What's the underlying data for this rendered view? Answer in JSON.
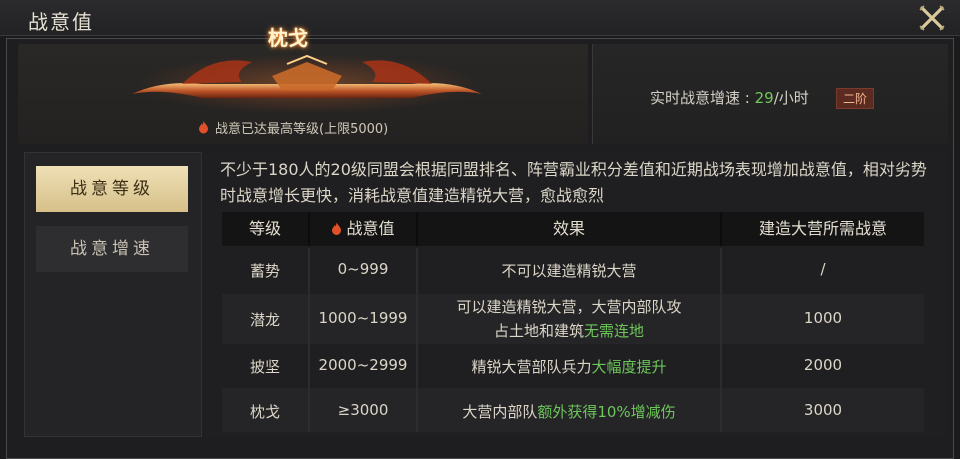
{
  "window": {
    "title": "战意值"
  },
  "hero": {
    "banner_name": "枕戈",
    "max_text": "战意已达最高等级(上限5000)"
  },
  "rate": {
    "prefix": "实时战意增速 : ",
    "value": "29",
    "unit": "/小时",
    "tier": "二阶"
  },
  "tabs": [
    {
      "label": "战意等级",
      "active": true
    },
    {
      "label": "战意增速",
      "active": false
    }
  ],
  "description": "不少于180人的20级同盟会根据同盟排名、阵营霸业积分差值和近期战场表现增加战意值，相对劣势时战意增长更快，消耗战意值建造精锐大营，愈战愈烈",
  "table": {
    "headers": [
      "等级",
      "战意值",
      "效果",
      "建造大营所需战意"
    ],
    "rows": [
      {
        "level": "蓄势",
        "value": "0~999",
        "effect": "不可以建造精锐大营",
        "effect_hl": "",
        "effect_line2": "",
        "effect_line2_hl": "",
        "cost": "/"
      },
      {
        "level": "潜龙",
        "value": "1000~1999",
        "effect": "可以建造精锐大营，大营内部队攻",
        "effect_hl": "",
        "effect_line2": "占土地和建筑",
        "effect_line2_hl": "无需连地",
        "cost": "1000"
      },
      {
        "level": "披坚",
        "value": "2000~2999",
        "effect": "精锐大营部队兵力",
        "effect_hl": "大幅度提升",
        "effect_line2": "",
        "effect_line2_hl": "",
        "cost": "2000"
      },
      {
        "level": "枕戈",
        "value": "≥3000",
        "effect": "大营内部队",
        "effect_hl": "额外获得10%增减伤",
        "effect_line2": "",
        "effect_line2_hl": "",
        "cost": "3000"
      }
    ]
  },
  "colors": {
    "accent_green": "#6dc65a",
    "tab_active": "#e6d3a0",
    "tier_bg": "#5b2a20"
  },
  "icons": {
    "close": "close-x-icon",
    "flame": "flame-icon"
  }
}
